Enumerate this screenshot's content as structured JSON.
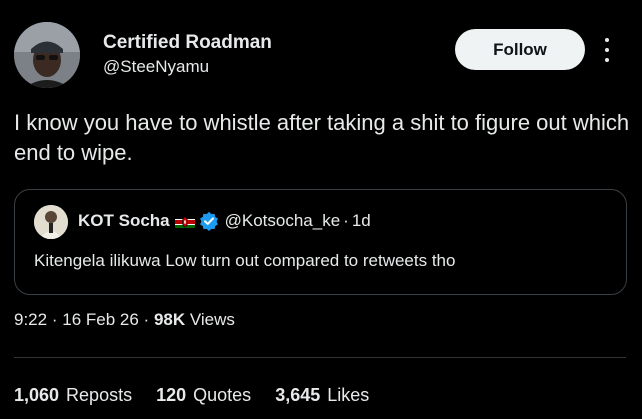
{
  "tweet": {
    "author": {
      "name": "Certified Roadman",
      "handle": "@SteeNyamu"
    },
    "follow_label": "Follow",
    "text": "I know you have to whistle after taking a shit to figure out which end to wipe.",
    "quoted": {
      "name": "KOT Socha",
      "flag_icon": "kenya-flag-icon",
      "verified_icon": "verified-badge-icon",
      "handle": "@Kotsocha_ke",
      "separator": "·",
      "time": "1d",
      "text": "Kitengela ilikuwa Low turn out compared to retweets tho"
    },
    "meta": {
      "time": "9:22",
      "date": "16 Feb 26",
      "views_count": "98K",
      "views_label": "Views",
      "separator": "·"
    },
    "stats": [
      {
        "count": "1,060",
        "label": "Reposts"
      },
      {
        "count": "120",
        "label": "Quotes"
      },
      {
        "count": "3,645",
        "label": "Likes"
      }
    ]
  },
  "colors": {
    "background": "#000000",
    "text": "#e7e9ea",
    "follow_bg": "#eff3f4",
    "verified": "#1d9bf0",
    "border": "#3a3f44"
  }
}
